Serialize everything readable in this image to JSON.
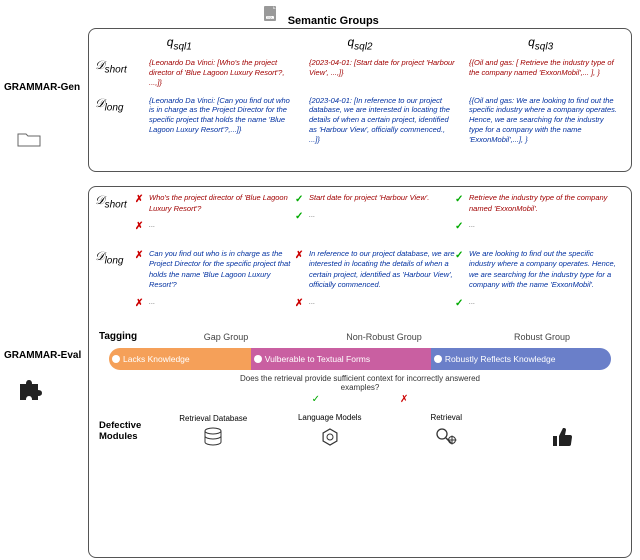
{
  "header": {
    "title": "Semantic Groups",
    "col1": "q",
    "col1sub": "sql1",
    "col2": "q",
    "col2sub": "sql2",
    "col3": "q",
    "col3sub": "sql3"
  },
  "left": {
    "gen": "GRAMMAR-Gen",
    "eval": "GRAMMAR-Eval"
  },
  "d_short_label": "𝒟",
  "d_short_sub": "short",
  "d_long_label": "𝒟",
  "d_long_sub": "long",
  "gen_short": {
    "c1": "{Leonardo Da Vinci: [Who's the project director of 'Blue Lagoon Luxury Resort'?, ...,]}",
    "c2": "{2023-04-01: [Start date for project 'Harbour View', ...,]}",
    "c3": "{{Oil and gas: [ Retrieve the industry type of the company named 'ExxonMobil',... ], }"
  },
  "gen_long": {
    "c1": "{Leonardo Da Vinci: [Can you find out who is in charge as the Project Director for the specific project that holds the name 'Blue Lagoon Luxury Resort'?,...]}",
    "c2": "{2023-04-01: [In reference to our project database, we are interested in locating the details of when a certain project, identified as 'Harbour View', officially commenced., ...]}",
    "c3": "{{Oil and gas: We are looking to find out the specific industry where a company operates. Hence, we are searching for the industry type for a company with the name 'ExxonMobil',...], }"
  },
  "eval_short": {
    "c1": "Who's the project director of 'Blue Lagoon Luxury Resort'?",
    "c2": "Start date for project 'Harbour View'.",
    "c3": "Retrieve the industry type of the company named 'ExxonMobil'."
  },
  "eval_long": {
    "c1": "Can you find out who is in charge as the Project Director for the specific project that holds the name 'Blue Lagoon Luxury Resort'?",
    "c2": "In reference to our project database, we are interested in locating the details of when a certain project, identified as 'Harbour View', officially commenced.",
    "c3": "We are looking to find out the specific industry where a company operates. Hence, we are searching for the industry type for a company with the name 'ExxonMobil'."
  },
  "ellipsis": "...",
  "tagging": {
    "label": "Tagging",
    "gap": "Gap Group",
    "nonrobust": "Non-Robust Group",
    "robust": "Robust Group"
  },
  "pills": {
    "p1": "Lacks Knowledge",
    "p2": "Vulberable to Textual Forms",
    "p3": "Robustly Reflects Knowledge"
  },
  "question": "Does the retrieval provide sufficient context for  incorrectly answered examples?",
  "modules": {
    "label": "Defective Modules",
    "m1": "Retrieval Database",
    "m2": "Language Models",
    "m3": "Retrieval"
  },
  "marks": {
    "short1": "x",
    "short2": "check",
    "short3": "check",
    "short1e": "x",
    "short2e": "check",
    "short3e": "check",
    "long1": "x",
    "long2": "x",
    "long3": "check",
    "long1e": "x",
    "long2e": "x",
    "long3e": "check",
    "q_yes": "check",
    "q_no": "x"
  }
}
